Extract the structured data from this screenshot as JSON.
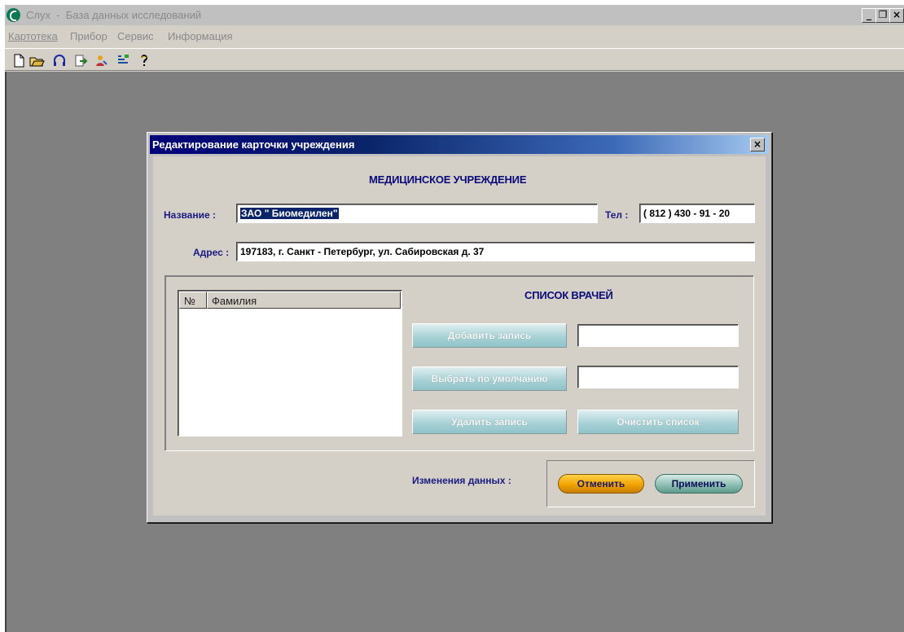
{
  "app": {
    "title": "Слух  -  База данных исследований",
    "window_buttons": {
      "minimize": "_",
      "maximize": "❐",
      "close": "×"
    }
  },
  "menu": [
    "Картотека",
    "Прибор",
    "Сервис",
    "Информация"
  ],
  "toolbar": {
    "buttons": [
      "new-file-icon",
      "open-folder-icon",
      "headphones-icon",
      "export-icon",
      "patient-icon",
      "list-icon",
      "help-icon"
    ]
  },
  "dialog": {
    "title": "Редактирование карточки учреждения",
    "close": "×",
    "section_title": "МЕДИЦИНСКОЕ УЧРЕЖДЕНИЕ",
    "name_label": "Название :",
    "name_value": "ЗАО \" Биомедилен\"",
    "phone_label": "Тел :",
    "phone_value": "( 812 ) 430 - 91 - 20",
    "address_label": "Адрес :",
    "address_value": "197183, г. Санкт - Петербург, ул. Сабировская д. 37",
    "doctors": {
      "title": "СПИСОК ВРАЧЕЙ",
      "columns": [
        "№",
        "Фамилия"
      ],
      "rows": [],
      "add_button": "Добавить запись",
      "add_value": "",
      "default_button": "Выбрать по умолчанию",
      "default_value": "",
      "delete_button": "Удалить запись",
      "clear_button": "Очистить список"
    },
    "changes_label": "Изменения данных :",
    "cancel_button": "Отменить",
    "apply_button": "Применить"
  },
  "colors": {
    "title_gradient_start": "#00007a",
    "title_gradient_end": "#a6caf0",
    "label_blue": "#1a1a80",
    "cancel_orange": "#f2a300",
    "apply_green": "#8fbfb3",
    "workspace_gray": "#808080"
  }
}
